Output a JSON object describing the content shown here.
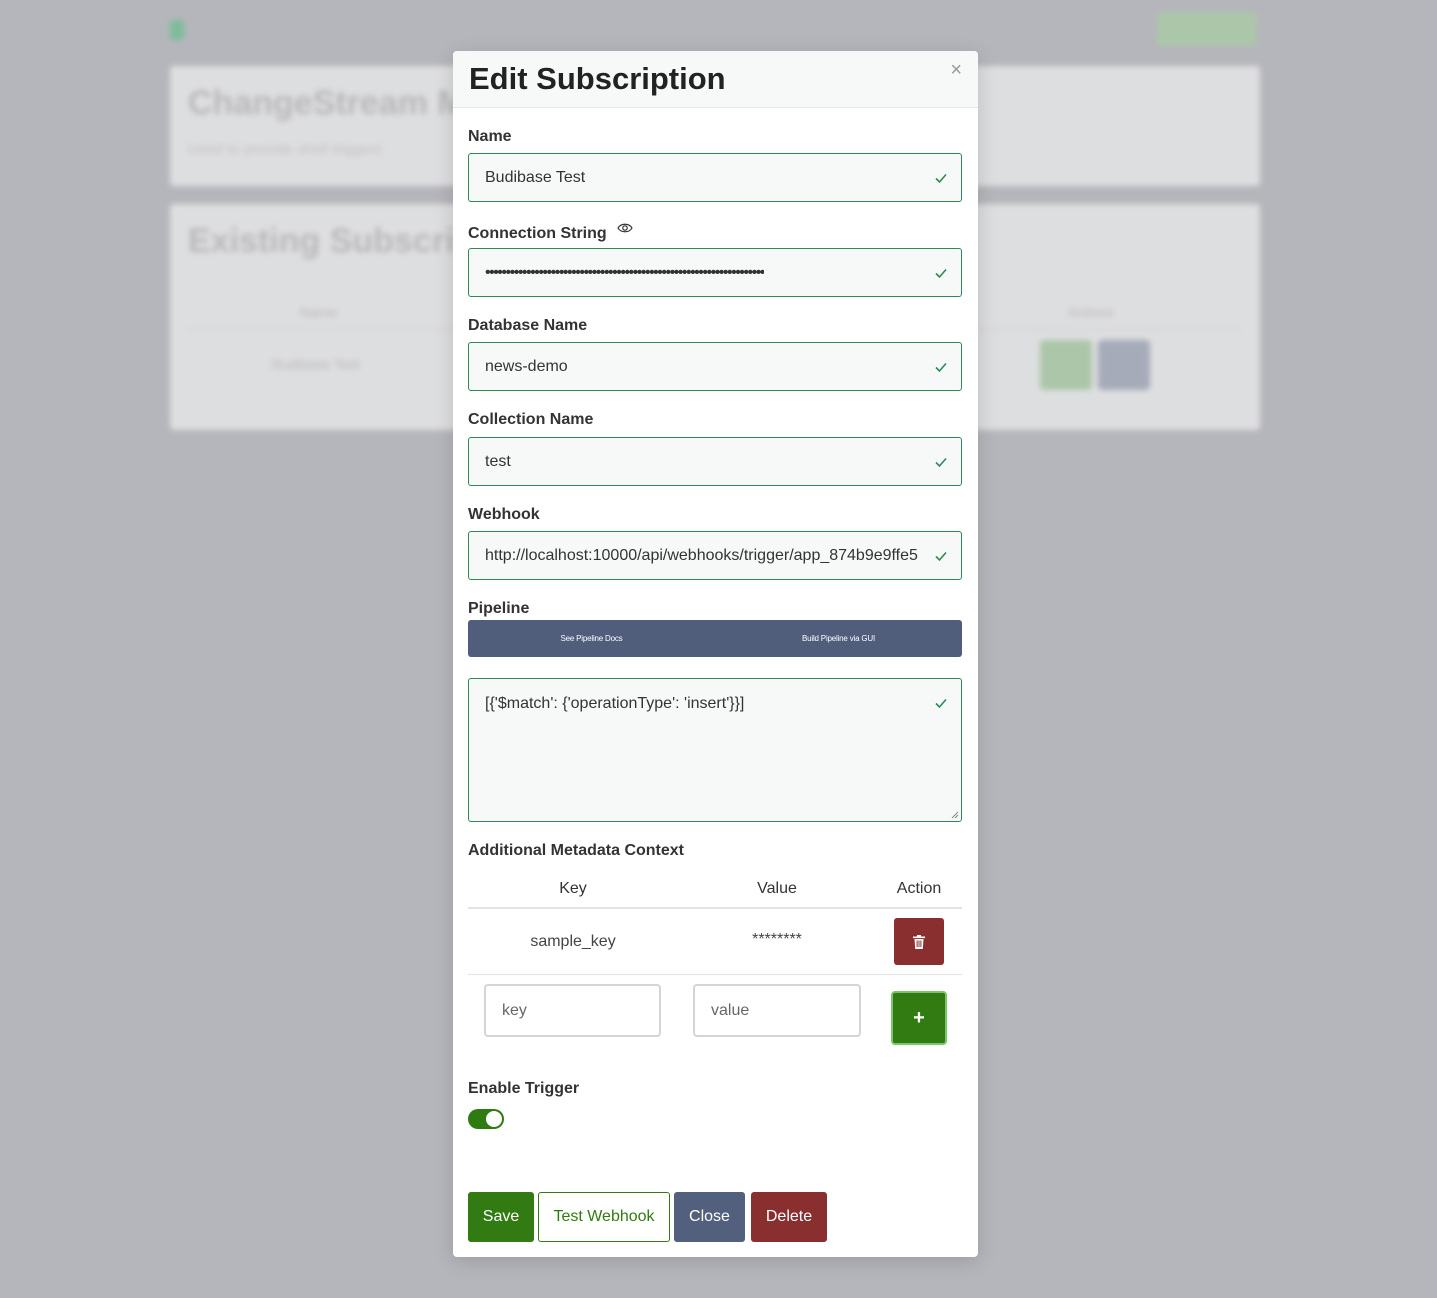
{
  "background": {
    "top_button": "",
    "card1_title": "ChangeStream Ma",
    "card1_subtitle": "Used to provide shell triggers",
    "card2_title": "Existing Subscripti",
    "table_headers": [
      "Name",
      "Actions"
    ],
    "row_name": "Budibase Test"
  },
  "modal": {
    "title": "Edit Subscription",
    "close_glyph": "×",
    "name": {
      "label": "Name",
      "value": "Budibase Test"
    },
    "connection_string": {
      "label": "Connection String",
      "value": "••••••••••••••••••••••••••••••••••••••••••••••••••••••••••••••••••••"
    },
    "database_name": {
      "label": "Database Name",
      "value": "news-demo"
    },
    "collection_name": {
      "label": "Collection Name",
      "value": "test"
    },
    "webhook": {
      "label": "Webhook",
      "value": "http://localhost:10000/api/webhooks/trigger/app_874b9e9ffe5"
    },
    "pipeline": {
      "label": "Pipeline",
      "docs_button": "See Pipeline Docs",
      "gui_button": "Build Pipeline via GUI",
      "value": "[{'$match': {'operationType': 'insert'}}]"
    },
    "metadata": {
      "label": "Additional Metadata Context",
      "headers": {
        "key": "Key",
        "value": "Value",
        "action": "Action"
      },
      "rows": [
        {
          "key": "sample_key",
          "value": "********"
        }
      ],
      "new_key_placeholder": "key",
      "new_value_placeholder": "value",
      "add_label": "+"
    },
    "enable_trigger": {
      "label": "Enable Trigger",
      "enabled": true
    },
    "buttons": {
      "save": "Save",
      "test_webhook": "Test Webhook",
      "close": "Close",
      "delete": "Delete"
    }
  },
  "colors": {
    "accent_green": "#317b12",
    "danger_red": "#8a2f2f",
    "slate": "#505e7c",
    "valid_border": "#2d8a58"
  },
  "icons": [
    "eye-icon",
    "check-icon",
    "trash-icon",
    "close-icon"
  ]
}
